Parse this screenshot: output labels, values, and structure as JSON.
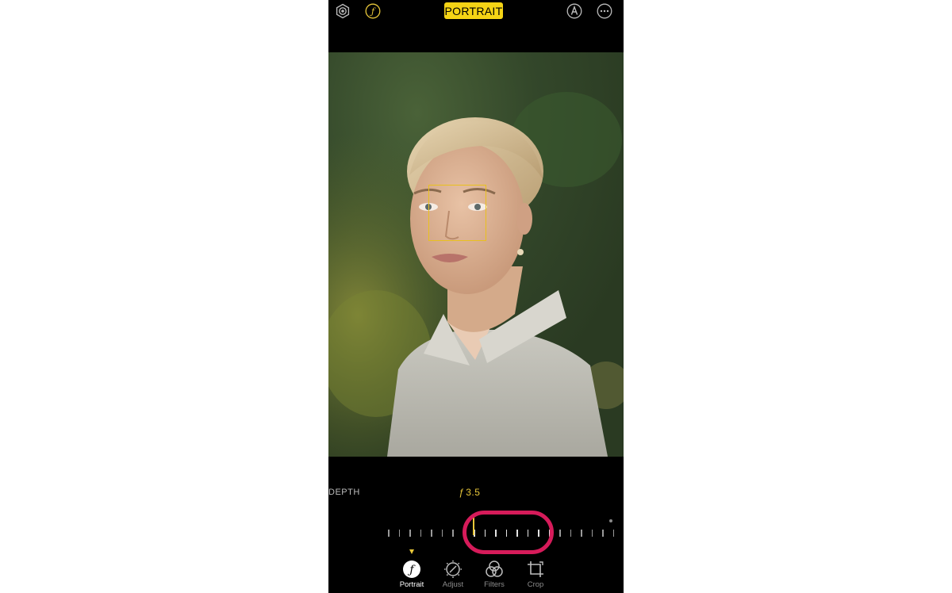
{
  "header": {
    "mode_badge": "PORTRAIT",
    "icons": [
      "live-photo-icon",
      "aperture-icon",
      "markup-icon",
      "more-icon"
    ],
    "accent_color": "#f5d415"
  },
  "depth_control": {
    "label": "DEPTH",
    "aperture_symbol": "ƒ",
    "aperture_value": "3.5",
    "highlight_color": "#d61b5a"
  },
  "tabs": [
    {
      "label": "Portrait",
      "icon": "aperture-icon",
      "active": true
    },
    {
      "label": "Adjust",
      "icon": "adjust-dial-icon",
      "active": false
    },
    {
      "label": "Filters",
      "icon": "filters-icon",
      "active": false
    },
    {
      "label": "Crop",
      "icon": "crop-icon",
      "active": false
    }
  ]
}
